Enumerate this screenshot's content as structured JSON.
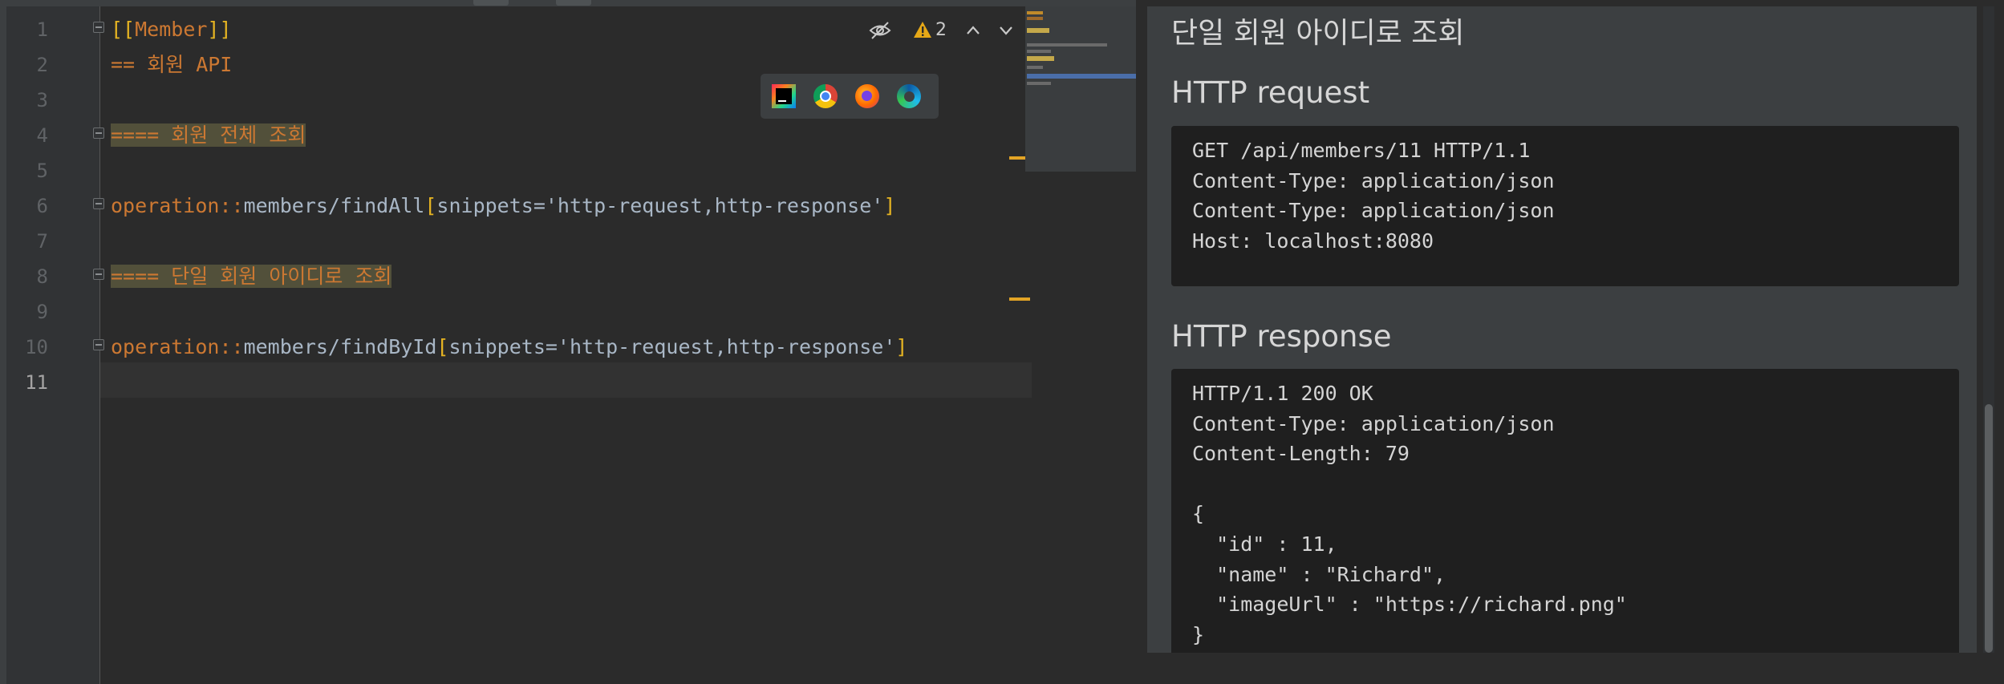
{
  "editor": {
    "line_numbers": [
      "1",
      "2",
      "3",
      "4",
      "5",
      "6",
      "7",
      "8",
      "9",
      "10",
      "11"
    ],
    "lines": {
      "l1": {
        "open": "[[",
        "anchor": "Member",
        "close": "]]"
      },
      "l2": {
        "text": "== 회원 API"
      },
      "l4": {
        "text": "==== 회원 전체 조회"
      },
      "l6": {
        "macro": "operation::",
        "target": "members/findAll",
        "open": "[",
        "attr": "snippets='http-request,http-response'",
        "close": "]"
      },
      "l8": {
        "text": "==== 단일 회원 아이디로 조회"
      },
      "l10": {
        "macro": "operation::",
        "target": "members/findById",
        "open": "[",
        "attr": "snippets='http-request,http-response'",
        "close": "]"
      }
    },
    "toolbar": {
      "hide_preview_icon": "eye-slash-icon",
      "warning_count": "2",
      "warning_icon": "warning-icon"
    },
    "browsers": [
      "intellij-icon",
      "chrome-icon",
      "firefox-icon",
      "edge-icon"
    ]
  },
  "preview": {
    "partial_heading": "단일 회원 아이디로 조회",
    "request_title": "HTTP request",
    "request_lines": [
      "GET /api/members/11 HTTP/1.1",
      "Content-Type: application/json",
      "Content-Type: application/json",
      "Host: localhost:8080"
    ],
    "response_title": "HTTP response",
    "response_lines": [
      "HTTP/1.1 200 OK",
      "Content-Type: application/json",
      "Content-Length: 79",
      "",
      "{",
      "  \"id\" : 11,",
      "  \"name\" : \"Richard\",",
      "  \"imageUrl\" : \"https://richard.png\"",
      "}"
    ]
  },
  "colors": {
    "keyword": "#cc7832",
    "bracket": "#e6b422",
    "text": "#a9b7c6",
    "highlight": "#52503a"
  }
}
